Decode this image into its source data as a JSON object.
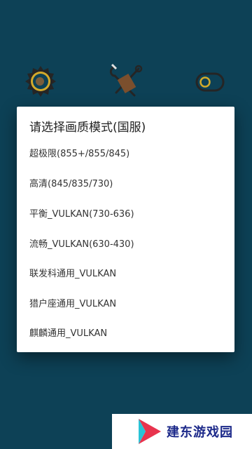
{
  "background_icons": {
    "gear": "gear-icon",
    "wrench": "wrench-icon",
    "toggle": "toggle-icon"
  },
  "dialog": {
    "title": "请选择画质模式(国服)",
    "options": [
      "超极限(855+/855/845)",
      "高清(845/835/730)",
      "平衡_VULKAN(730-636)",
      "流畅_VULKAN(630-430)",
      "联发科通用_VULKAN",
      "猎户座通用_VULKAN",
      "麒麟通用_VULKAN"
    ]
  },
  "watermark": {
    "text": "建东游戏园"
  },
  "colors": {
    "background": "#0f4a62",
    "dialog": "#ffffff",
    "watermark_text": "#1d2a8a",
    "logo_red": "#e8344e",
    "logo_cyan": "#29c3d6"
  }
}
